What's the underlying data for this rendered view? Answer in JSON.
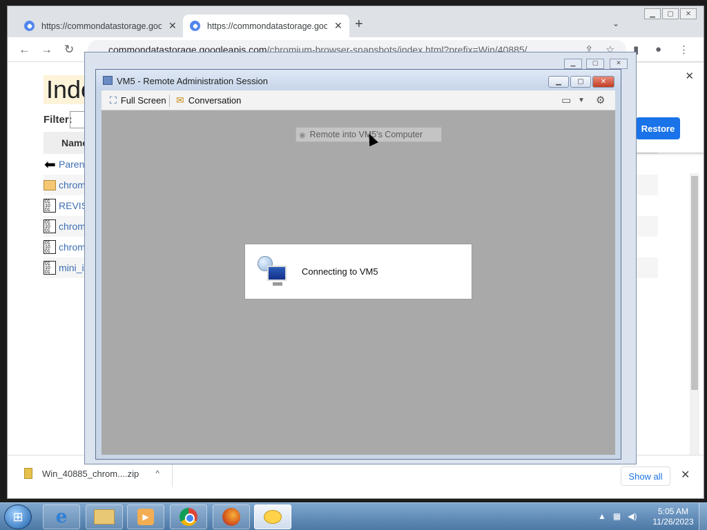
{
  "browser": {
    "tabs": [
      {
        "title": "https://commondatastorage.goo"
      },
      {
        "title": "https://commondatastorage.goo"
      }
    ],
    "address": {
      "host": "commondatastorage.googleapis.com",
      "path": "/chromium-browser-snapshots/index.html?prefix=Win/40885/"
    },
    "page": {
      "title": "Inde",
      "filter_label": "Filter:",
      "column_header": "Name",
      "rows": [
        "Parent",
        "chrom",
        "REVIS",
        "chrom",
        "chrom",
        "mini_i"
      ]
    },
    "restore_label": "Restore",
    "download": {
      "filename": "Win_40885_chrom....zip",
      "show_all": "Show all"
    }
  },
  "session": {
    "title": "VM5 - Remote Administration Session",
    "toolbar": {
      "full_screen": "Full Screen",
      "conversation": "Conversation"
    },
    "remote_into": "Remote into VM5's Computer",
    "status": "Connecting to VM5"
  },
  "taskbar": {
    "time": "5:05 AM",
    "date": "11/26/2023"
  }
}
